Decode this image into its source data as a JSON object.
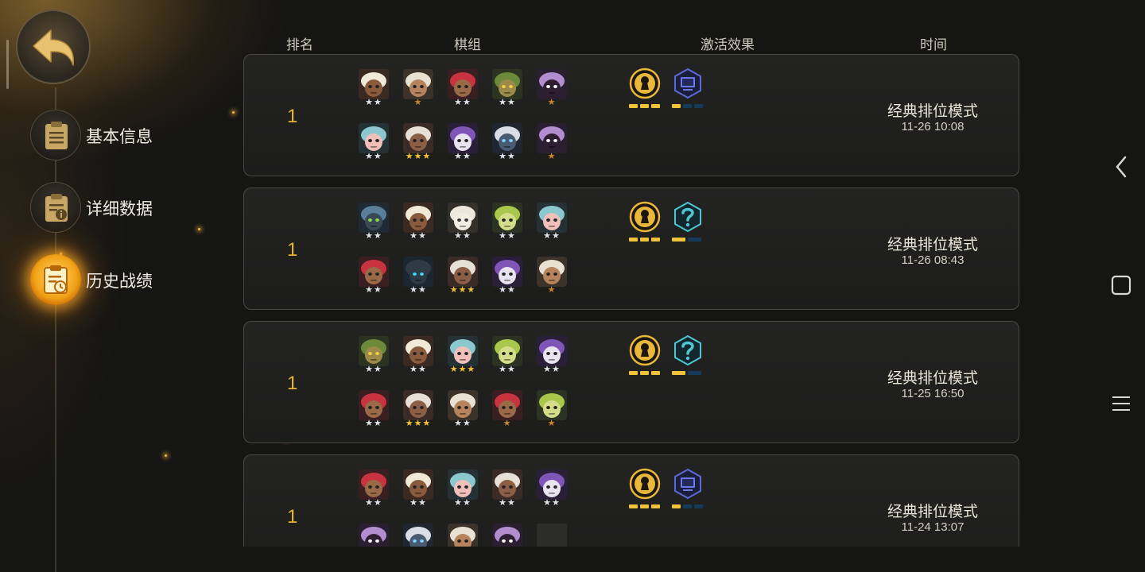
{
  "sidebar": {
    "items": [
      {
        "label": "基本信息",
        "icon": "clipboard-icon"
      },
      {
        "label": "详细数据",
        "icon": "info-doc-icon"
      },
      {
        "label": "历史战绩",
        "icon": "history-clock-icon"
      }
    ],
    "active_index": 2
  },
  "header": {
    "rank": "排名",
    "lineup": "棋组",
    "effects": "激活效果",
    "time": "时间"
  },
  "colors": {
    "accent_gold": "#f0c23a",
    "rank_gold": "#e8b42a",
    "star_bronze": "#c8852b",
    "star_silver": "#dfe3ea",
    "star_gold": "#f2c232"
  },
  "records": [
    {
      "rank": "1",
      "mode": "经典排位模式",
      "time": "11-26 10:08",
      "units": [
        {
          "name": "turban-warrior",
          "stars": 2
        },
        {
          "name": "white-beard-elder",
          "stars": 1
        },
        {
          "name": "red-demon",
          "stars": 2
        },
        {
          "name": "green-goblin",
          "stars": 2
        },
        {
          "name": "purple-masked",
          "stars": 1
        },
        {
          "name": "teal-hood",
          "stars": 2
        },
        {
          "name": "bald-brute",
          "stars": 3
        },
        {
          "name": "purple-witch",
          "stars": 2
        },
        {
          "name": "dark-knight",
          "stars": 2
        },
        {
          "name": "purple-masked",
          "stars": 1
        }
      ],
      "synergies": [
        {
          "icon": "keyhole-badge-icon",
          "levels": 3,
          "active": 3,
          "type": "gold"
        },
        {
          "icon": "screen-badge-icon",
          "levels": 3,
          "active": 1,
          "type": "blue"
        }
      ]
    },
    {
      "rank": "1",
      "mode": "经典排位模式",
      "time": "11-26 08:43",
      "units": [
        {
          "name": "blue-robot",
          "stars": 2
        },
        {
          "name": "turban-warrior",
          "stars": 2
        },
        {
          "name": "white-ghost",
          "stars": 2
        },
        {
          "name": "green-sprout",
          "stars": 2
        },
        {
          "name": "teal-hood",
          "stars": 2
        },
        {
          "name": "red-demon",
          "stars": 2
        },
        {
          "name": "cyan-helmet",
          "stars": 2
        },
        {
          "name": "bald-brute",
          "stars": 3
        },
        {
          "name": "purple-witch",
          "stars": 2
        },
        {
          "name": "white-beard-elder",
          "stars": 1
        }
      ],
      "synergies": [
        {
          "icon": "keyhole-badge-icon",
          "levels": 3,
          "active": 3,
          "type": "gold"
        },
        {
          "icon": "question-badge-icon",
          "levels": 2,
          "active": 1,
          "type": "blue"
        }
      ]
    },
    {
      "rank": "1",
      "mode": "经典排位模式",
      "time": "11-25 16:50",
      "units": [
        {
          "name": "green-goblin",
          "stars": 2
        },
        {
          "name": "turban-warrior",
          "stars": 2
        },
        {
          "name": "teal-hood",
          "stars": 3
        },
        {
          "name": "green-sprout",
          "stars": 2
        },
        {
          "name": "purple-witch",
          "stars": 2
        },
        {
          "name": "red-demon",
          "stars": 2
        },
        {
          "name": "bald-brute",
          "stars": 3
        },
        {
          "name": "white-beard-elder",
          "stars": 2
        },
        {
          "name": "red-demon",
          "stars": 1
        },
        {
          "name": "green-sprout",
          "stars": 1
        }
      ],
      "synergies": [
        {
          "icon": "keyhole-badge-icon",
          "levels": 3,
          "active": 3,
          "type": "gold"
        },
        {
          "icon": "question-badge-icon",
          "levels": 2,
          "active": 1,
          "type": "blue"
        }
      ]
    },
    {
      "rank": "1",
      "mode": "经典排位模式",
      "time": "11-24 13:07",
      "units": [
        {
          "name": "red-demon",
          "stars": 2
        },
        {
          "name": "turban-warrior",
          "stars": 2
        },
        {
          "name": "teal-hood",
          "stars": 2
        },
        {
          "name": "bald-brute",
          "stars": 2
        },
        {
          "name": "purple-witch",
          "stars": 2
        },
        {
          "name": "purple-masked",
          "stars": 0
        },
        {
          "name": "dark-knight",
          "stars": 0
        },
        {
          "name": "white-beard-elder",
          "stars": 0
        },
        {
          "name": "purple-masked",
          "stars": 0
        },
        {
          "name": "empty",
          "stars": 0
        }
      ],
      "synergies": [
        {
          "icon": "keyhole-badge-icon",
          "levels": 3,
          "active": 3,
          "type": "gold"
        },
        {
          "icon": "screen-badge-icon",
          "levels": 3,
          "active": 1,
          "type": "blue"
        }
      ]
    }
  ],
  "system_nav": {
    "back": "chevron-left-icon",
    "home": "square-icon",
    "menu": "hamburger-icon"
  }
}
